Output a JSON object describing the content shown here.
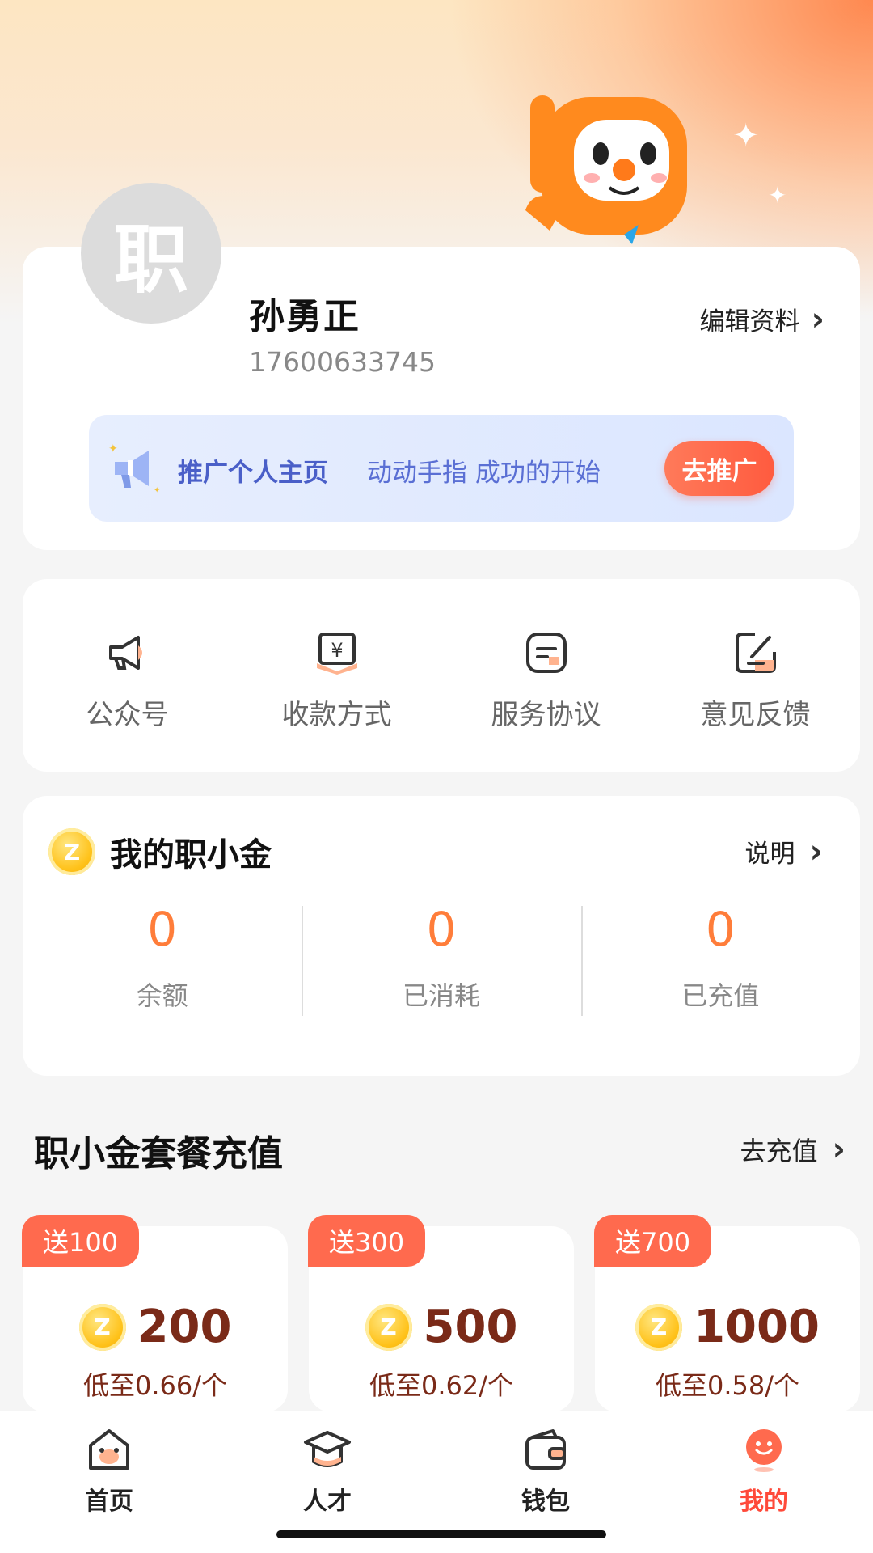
{
  "profile": {
    "avatar_text": "职",
    "name": "孙勇正",
    "phone": "17600633745",
    "edit_label": "编辑资料"
  },
  "promo": {
    "title": "推广个人主页",
    "subtitle": "动动手指 成功的开始",
    "button_label": "去推广"
  },
  "menu": {
    "items": [
      {
        "label": "公众号",
        "icon": "megaphone-icon"
      },
      {
        "label": "收款方式",
        "icon": "payment-icon"
      },
      {
        "label": "服务协议",
        "icon": "agreement-icon"
      },
      {
        "label": "意见反馈",
        "icon": "feedback-icon"
      }
    ]
  },
  "coins": {
    "coin_letter": "Z",
    "title": "我的职小金",
    "info_label": "说明",
    "stats": [
      {
        "value": "0",
        "label": "余额"
      },
      {
        "value": "0",
        "label": "已消耗"
      },
      {
        "value": "0",
        "label": "已充值"
      }
    ]
  },
  "recharge": {
    "title": "职小金套餐充值",
    "link_label": "去充值",
    "packages": [
      {
        "tag": "送100",
        "amount": "200",
        "price": "低至0.66/个"
      },
      {
        "tag": "送300",
        "amount": "500",
        "price": "低至0.62/个"
      },
      {
        "tag": "送700",
        "amount": "1000",
        "price": "低至0.58/个"
      }
    ]
  },
  "tabbar": {
    "tabs": [
      {
        "label": "首页",
        "icon": "home-icon"
      },
      {
        "label": "人才",
        "icon": "talent-icon"
      },
      {
        "label": "钱包",
        "icon": "wallet-icon"
      },
      {
        "label": "我的",
        "icon": "profile-icon",
        "active": true
      }
    ]
  },
  "colors": {
    "accent": "#ff7d3a",
    "active_tab": "#ff4a3a",
    "promo_text": "#4a5fc8"
  }
}
